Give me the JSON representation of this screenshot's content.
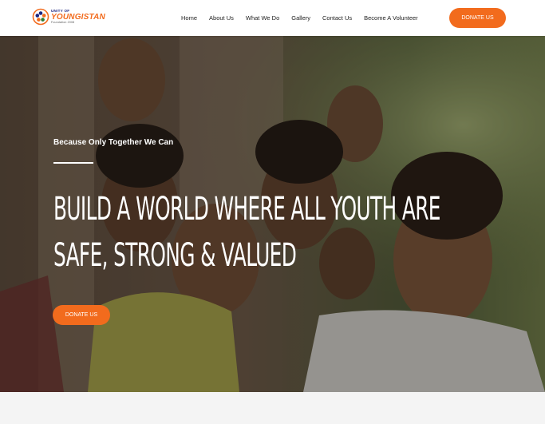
{
  "brand": {
    "small": "UNITY OF",
    "name": "YOUNGISTAN",
    "foundation": "Foundation 2008",
    "logo_icon": "flower-emblem-icon",
    "colors": {
      "accent": "#f26b1d",
      "navy": "#1a237e"
    }
  },
  "nav": {
    "items": [
      {
        "label": "Home"
      },
      {
        "label": "About Us"
      },
      {
        "label": "What We Do"
      },
      {
        "label": "Gallery"
      },
      {
        "label": "Contact Us"
      },
      {
        "label": "Become A Volunteer"
      }
    ],
    "donate_label": "DONATE US"
  },
  "hero": {
    "tagline": "Because Only Together We Can",
    "headline_line1": "BUILD A WORLD WHERE ALL YOUTH ARE",
    "headline_line2": "SAFE, STRONG & VALUED",
    "donate_label": "DONATE US"
  }
}
